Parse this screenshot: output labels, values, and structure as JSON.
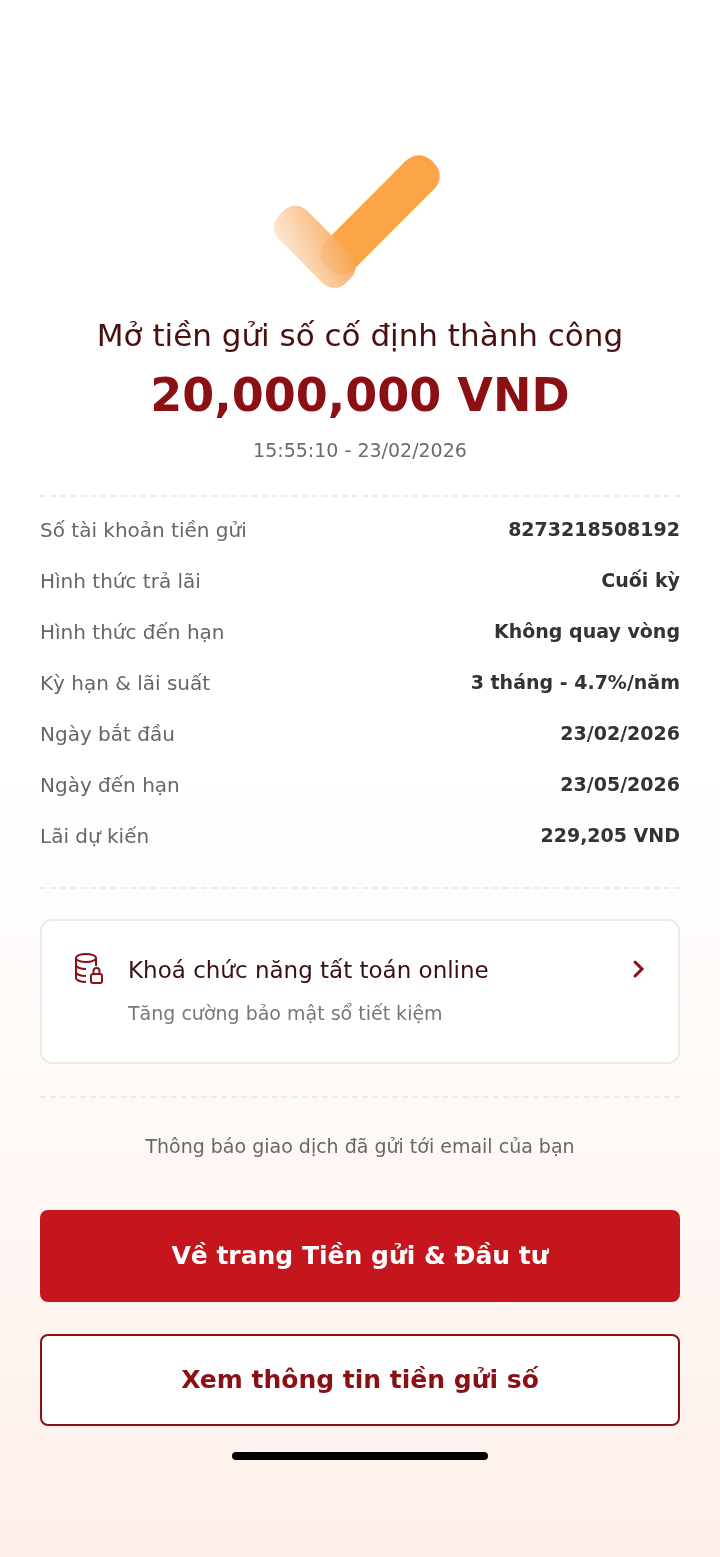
{
  "title": "Mở tiền gửi số cố định thành công",
  "amount": "20,000,000 VND",
  "timestamp": "15:55:10 - 23/02/2026",
  "details": [
    {
      "label": "Số tài khoản tiền gửi",
      "value": "8273218508192"
    },
    {
      "label": "Hình thức trả lãi",
      "value": "Cuối kỳ"
    },
    {
      "label": "Hình thức đến hạn",
      "value": "Không quay vòng"
    },
    {
      "label": "Kỳ hạn & lãi suất",
      "value": "3 tháng - 4.7%/năm"
    },
    {
      "label": "Ngày bắt đầu",
      "value": "23/02/2026"
    },
    {
      "label": "Ngày đến hạn",
      "value": "23/05/2026"
    },
    {
      "label": "Lãi dự kiến",
      "value": "229,205 VND"
    }
  ],
  "lock_card": {
    "title": "Khoá chức năng tất toán online",
    "subtitle": "Tăng cường bảo mật sổ tiết kiệm"
  },
  "notice": "Thông báo giao dịch đã gửi tới email của bạn",
  "buttons": [
    {
      "kind": "primary",
      "label": "Về trang Tiền gửi & Đầu tư"
    },
    {
      "kind": "secondary",
      "label": "Xem thông tin tiền gửi số"
    }
  ]
}
